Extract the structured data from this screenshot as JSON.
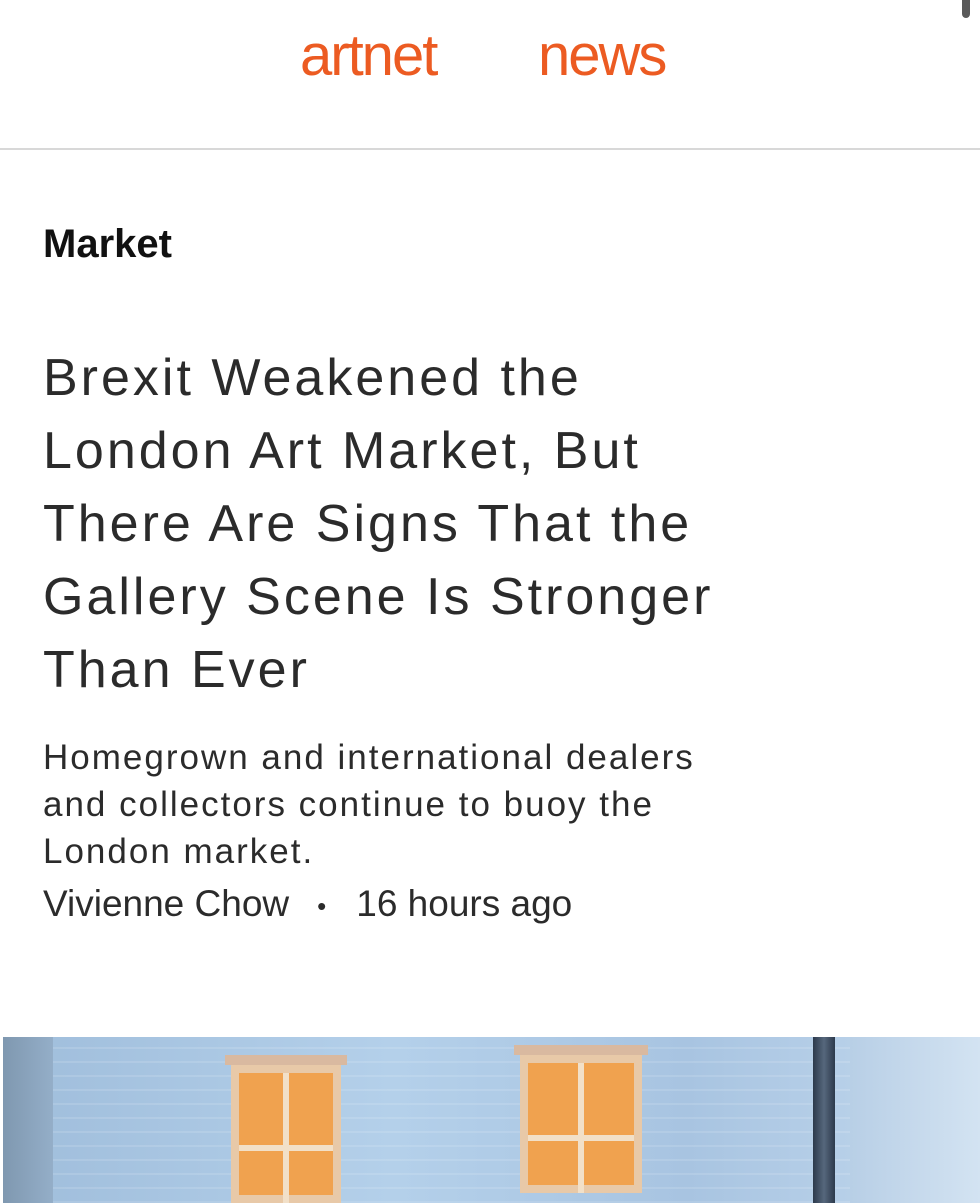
{
  "header": {
    "logo_word_1": "artnet",
    "logo_word_2": "news",
    "brand_color": "#ec5b22"
  },
  "article": {
    "category": "Market",
    "headline_lines": [
      "Brexit Weakened the",
      "London Art Market, But",
      "There Are Signs That the",
      "Gallery Scene Is Stronger",
      "Than Ever"
    ],
    "dek_lines": [
      "Homegrown and international dealers",
      "and collectors continue to buoy the",
      "London market."
    ],
    "author": "Vivienne Chow",
    "separator": "•",
    "timestamp": "16 hours ago"
  },
  "image": {
    "subject": "building-facade-photo"
  }
}
